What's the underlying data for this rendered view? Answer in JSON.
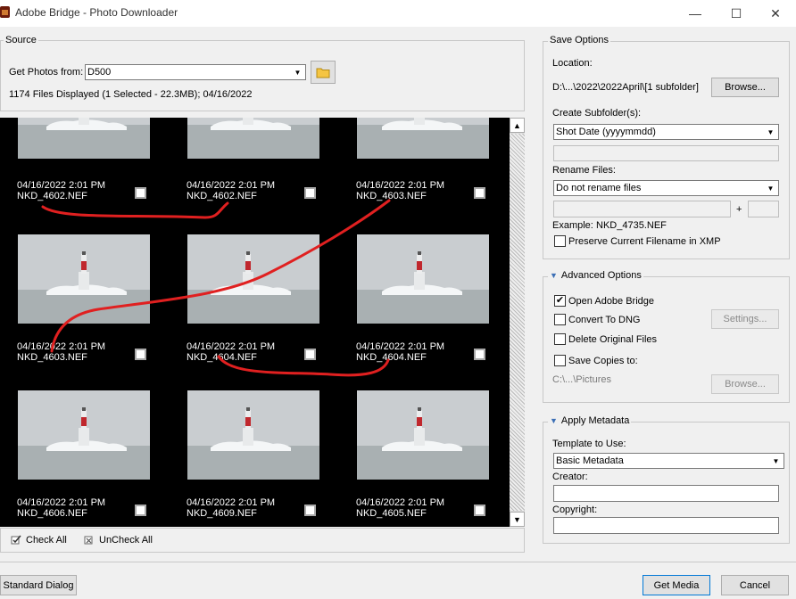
{
  "window": {
    "title": "Adobe Bridge - Photo Downloader",
    "minimize": "—",
    "maximize": "☐",
    "close": "✕"
  },
  "source": {
    "legend": "Source",
    "get_photos_label": "Get Photos from:",
    "get_photos_value": "D500",
    "status": "1174 Files Displayed (1 Selected - 22.3MB); 04/16/2022"
  },
  "thumbnails": [
    {
      "date": "04/16/2022 2:01 PM",
      "name": "NKD_4602.NEF",
      "checked": false
    },
    {
      "date": "04/16/2022 2:01 PM",
      "name": "NKD_4602.NEF",
      "checked": false
    },
    {
      "date": "04/16/2022 2:01 PM",
      "name": "NKD_4603.NEF",
      "checked": false
    },
    {
      "date": "04/16/2022 2:01 PM",
      "name": "NKD_4603.NEF",
      "checked": false
    },
    {
      "date": "04/16/2022 2:01 PM",
      "name": "NKD_4604.NEF",
      "checked": false
    },
    {
      "date": "04/16/2022 2:01 PM",
      "name": "NKD_4604.NEF",
      "checked": false
    },
    {
      "date": "04/16/2022 2:01 PM",
      "name": "NKD_4606.NEF",
      "checked": false
    },
    {
      "date": "04/16/2022 2:01 PM",
      "name": "NKD_4609.NEF",
      "checked": false
    },
    {
      "date": "04/16/2022 2:01 PM",
      "name": "NKD_4605.NEF",
      "checked": false
    }
  ],
  "grid_footer": {
    "check_all": "Check All",
    "uncheck_all": "UnCheck All"
  },
  "save_options": {
    "legend": "Save Options",
    "location_label": "Location:",
    "location_value": "D:\\...\\2022\\2022April\\[1 subfolder]",
    "browse": "Browse...",
    "create_subfolder_label": "Create Subfolder(s):",
    "create_subfolder_value": "Shot Date (yyyymmdd)",
    "rename_label": "Rename Files:",
    "rename_value": "Do not rename files",
    "plus": "+",
    "example_label": "Example:",
    "example_value": "NKD_4735.NEF",
    "preserve_label": "Preserve Current Filename in XMP",
    "preserve_checked": false
  },
  "advanced": {
    "legend": "Advanced Options",
    "open_bridge": "Open Adobe Bridge",
    "open_bridge_checked": true,
    "convert_dng": "Convert To DNG",
    "convert_dng_checked": false,
    "settings": "Settings...",
    "delete_original": "Delete Original Files",
    "delete_original_checked": false,
    "save_copies": "Save Copies to:",
    "save_copies_checked": false,
    "copies_path": "C:\\...\\Pictures",
    "browse": "Browse..."
  },
  "metadata": {
    "legend": "Apply Metadata",
    "template_label": "Template to Use:",
    "template_value": "Basic Metadata",
    "creator_label": "Creator:",
    "creator_value": "",
    "copyright_label": "Copyright:",
    "copyright_value": ""
  },
  "footer": {
    "standard_dialog": "Standard Dialog",
    "get_media": "Get Media",
    "cancel": "Cancel"
  },
  "colors": {
    "annotation_stroke": "#e02020",
    "grid_background": "#000000",
    "sky": "#c9cdd0",
    "lighthouse_red": "#c0272d"
  }
}
